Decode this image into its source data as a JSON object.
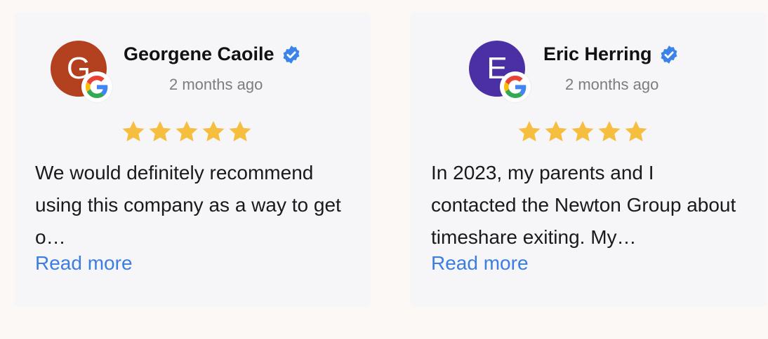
{
  "reviews": [
    {
      "initial": "G",
      "avatar_color": "#b3401f",
      "name": "Georgene Caoile",
      "time": "2 months ago",
      "rating": 5,
      "text": "We would definitely recommend using this company as a way to get o…",
      "read_more": "Read more"
    },
    {
      "initial": "E",
      "avatar_color": "#4b2fa4",
      "name": "Eric Herring",
      "time": "2 months ago",
      "rating": 5,
      "text": "In 2023, my parents and I contacted the Newton Group about timeshare exiting. My…",
      "read_more": "Read more"
    }
  ],
  "colors": {
    "star": "#f6be3e",
    "verified": "#3b83e8",
    "link": "#3b7de0"
  },
  "icons": {
    "badge": "google-g-icon",
    "verified": "verified-check-icon",
    "star": "star-icon"
  }
}
